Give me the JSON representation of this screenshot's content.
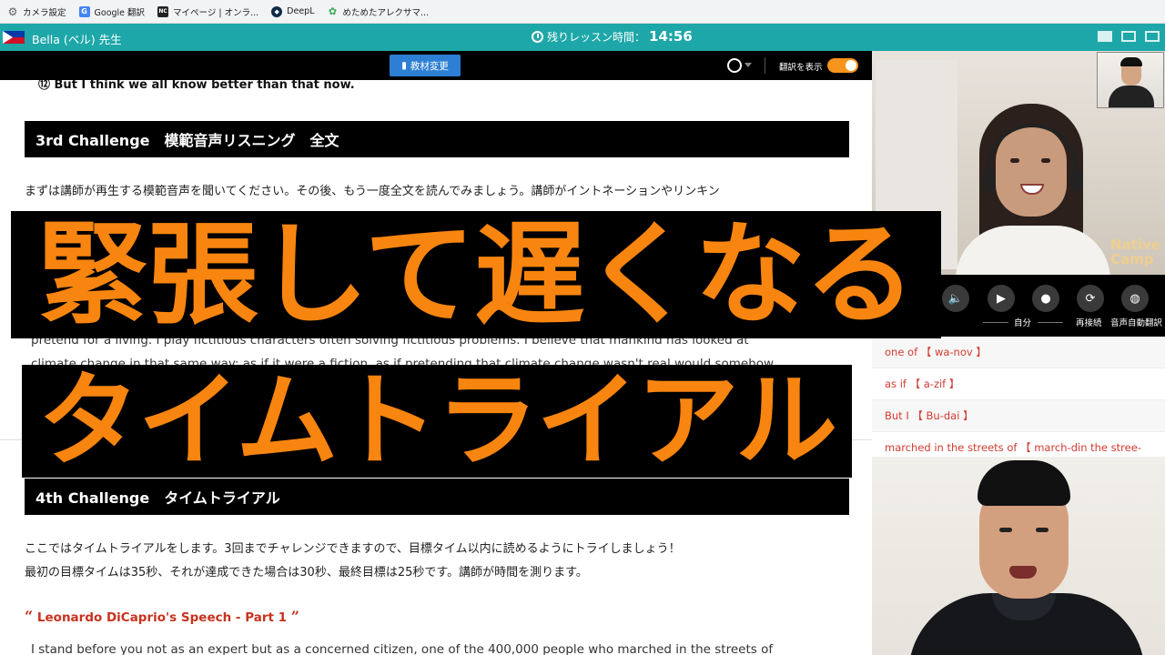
{
  "bookmarks": [
    {
      "label": "カメラ設定",
      "icon": "gear-icon"
    },
    {
      "label": "Google 翻訳",
      "icon": "google-translate-icon"
    },
    {
      "label": "マイページ | オンラ...",
      "icon": "nc-icon"
    },
    {
      "label": "DeepL",
      "icon": "deepl-icon"
    },
    {
      "label": "めためたアレクサマ...",
      "icon": "leaf-icon"
    }
  ],
  "header": {
    "teacher_name": "Bella (ベル) 先生",
    "timer_label": "残りレッスン時間：",
    "timer_value": "14:56",
    "color": "#1ea7a8"
  },
  "toolbar": {
    "material_button": "教材変更",
    "translation_label": "翻訳を表示",
    "translation_on": true
  },
  "material": {
    "cut_line": "⑫ But I think we all know better than that now.",
    "section3_title": "3rd Challenge　模範音声リスニング　全文",
    "section3_text": "まずは講師が再生する模範音声を聞いてください。その後、もう一度全文を読んでみましょう。講師がイントネーションやリンキン",
    "faint_line1": "pretend for a living. I play fictitious characters often solving fictitious problems. I believe that mankind has looked at",
    "faint_line2": "climate change in that same way: as if it were a fiction, as if pretending that climate change wasn't real would somehow",
    "section4_title": "4th Challenge　タイムトライアル",
    "section4_text1": "ここではタイムトライアルをします。3回までチャレンジできますので、目標タイム以内に読めるようにトライしましょう！",
    "section4_text2": "最初の目標タイムは35秒、それが達成できた場合は30秒、最終目標は25秒です。講師が時間を測ります。",
    "speech_open_quote": "“",
    "speech_title": "Leonardo DiCaprio's Speech - Part 1",
    "speech_close_quote": "”",
    "speech_text": "I stand before you not as an expert but as a concerned citizen, one of the 400,000 people who marched in the streets of"
  },
  "captions": {
    "line1": "緊張して遅くなる",
    "line2": "タイムトライアル",
    "color": "#f7850f"
  },
  "video": {
    "brand_text_1": "Native",
    "brand_text_2": "Camp"
  },
  "controls": [
    {
      "name": "speaker",
      "label": "",
      "glyph": "🔈"
    },
    {
      "name": "camera",
      "label": "",
      "glyph": "▶"
    },
    {
      "name": "mic",
      "label": "自分",
      "glyph": "●"
    },
    {
      "name": "reconnect",
      "label": "再接続",
      "glyph": "⟳"
    },
    {
      "name": "auto-translate",
      "label": "音声自動翻訳",
      "glyph": "◍"
    }
  ],
  "vocab": [
    "one of 【 wa-nov 】",
    "as if 【 a-zif 】",
    "But I 【 Bu-dai 】",
    "marched in the streets of 【 march-din the stree-"
  ]
}
